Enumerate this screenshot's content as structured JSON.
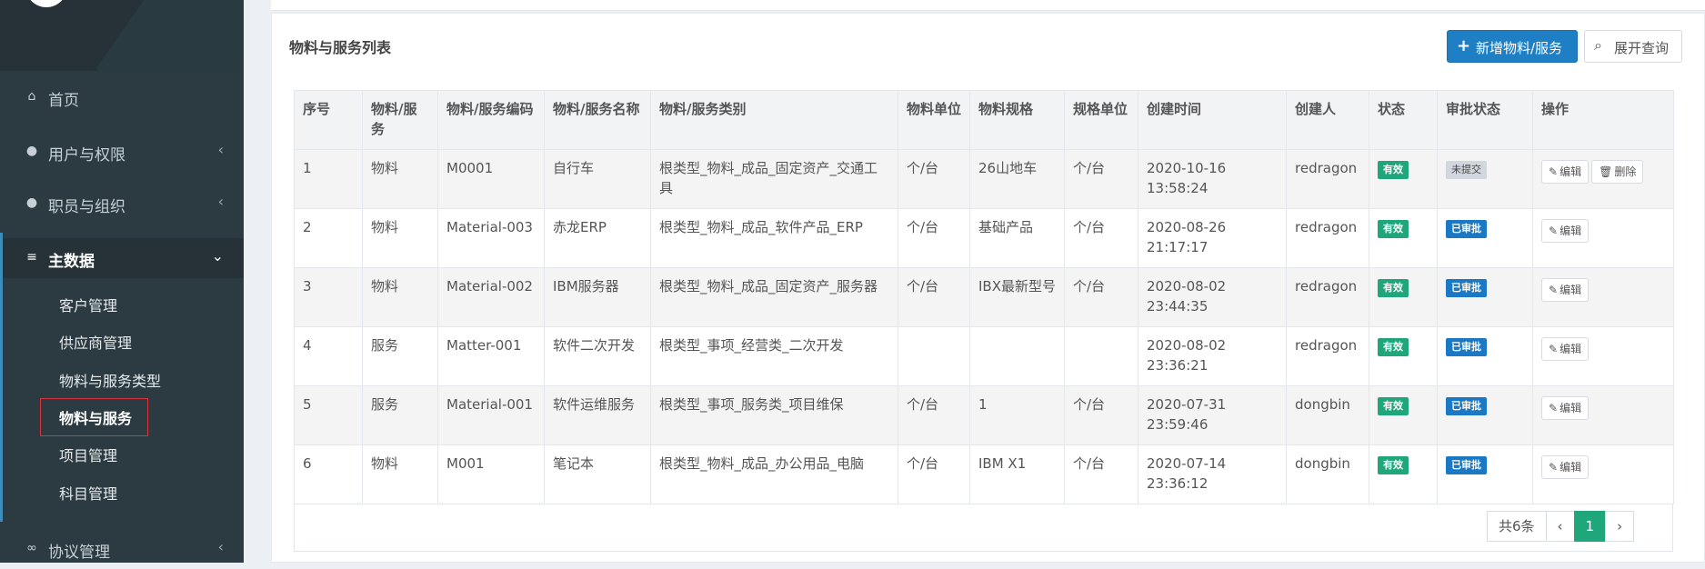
{
  "sidebar": {
    "items": [
      {
        "label": "首页",
        "icon": "home-icon",
        "glyph": "⌂"
      },
      {
        "label": "用户与权限",
        "icon": "lock-icon",
        "glyph": "●",
        "chevron": "‹"
      },
      {
        "label": "职员与组织",
        "icon": "user-circle-icon",
        "glyph": "●",
        "chevron": "‹"
      },
      {
        "label": "主数据",
        "icon": "database-icon",
        "glyph": "≡",
        "chevron": "⌄"
      },
      {
        "label": "协议管理",
        "icon": "handshake-icon",
        "glyph": "∞",
        "chevron": "‹"
      }
    ],
    "sub_items": [
      "客户管理",
      "供应商管理",
      "物料与服务类型",
      "物料与服务",
      "项目管理",
      "科目管理"
    ]
  },
  "panel": {
    "title": "物料与服务列表",
    "add_button": "新增物料/服务",
    "add_icon": "plus-icon",
    "expand_button": "展开查询",
    "expand_icon": "search-icon"
  },
  "table": {
    "headers": [
      "序号",
      "物料/服务",
      "物料/服务编码",
      "物料/服务名称",
      "物料/服务类别",
      "物料单位",
      "物料规格",
      "规格单位",
      "创建时间",
      "创建人",
      "状态",
      "审批状态",
      "操作"
    ],
    "rows": [
      {
        "no": "1",
        "type": "物料",
        "code": "M0001",
        "name": "自行车",
        "category": "根类型_物料_成品_固定资产_交通工具",
        "unit": "个/台",
        "spec": "26山地车",
        "spec_unit": "个/台",
        "created": "2020-10-16 13:58:24",
        "creator": "redragon",
        "status": "有效",
        "approval": "未提交",
        "edit": "编辑",
        "delete": "删除"
      },
      {
        "no": "2",
        "type": "物料",
        "code": "Material-003",
        "name": "赤龙ERP",
        "category": "根类型_物料_成品_软件产品_ERP",
        "unit": "个/台",
        "spec": "基础产品",
        "spec_unit": "个/台",
        "created": "2020-08-26 21:17:17",
        "creator": "redragon",
        "status": "有效",
        "approval": "已审批",
        "edit": "编辑"
      },
      {
        "no": "3",
        "type": "物料",
        "code": "Material-002",
        "name": "IBM服务器",
        "category": "根类型_物料_成品_固定资产_服务器",
        "unit": "个/台",
        "spec": "IBX最新型号",
        "spec_unit": "个/台",
        "created": "2020-08-02 23:44:35",
        "creator": "redragon",
        "status": "有效",
        "approval": "已审批",
        "edit": "编辑"
      },
      {
        "no": "4",
        "type": "服务",
        "code": "Matter-001",
        "name": "软件二次开发",
        "category": "根类型_事项_经营类_二次开发",
        "unit": "",
        "spec": "",
        "spec_unit": "",
        "created": "2020-08-02 23:36:21",
        "creator": "redragon",
        "status": "有效",
        "approval": "已审批",
        "edit": "编辑"
      },
      {
        "no": "5",
        "type": "服务",
        "code": "Material-001",
        "name": "软件运维服务",
        "category": "根类型_事项_服务类_项目维保",
        "unit": "个/台",
        "spec": "1",
        "spec_unit": "个/台",
        "created": "2020-07-31 23:59:46",
        "creator": "dongbin",
        "status": "有效",
        "approval": "已审批",
        "edit": "编辑"
      },
      {
        "no": "6",
        "type": "物料",
        "code": "M001",
        "name": "笔记本",
        "category": "根类型_物料_成品_办公用品_电脑",
        "unit": "个/台",
        "spec": "IBM X1",
        "spec_unit": "个/台",
        "created": "2020-07-14 23:36:12",
        "creator": "dongbin",
        "status": "有效",
        "approval": "已审批",
        "edit": "编辑"
      }
    ]
  },
  "pager": {
    "total": "共6条",
    "prev": "‹",
    "current": "1",
    "next": "›"
  },
  "colors": {
    "sidebar": "#2c3b41",
    "primary": "#1f7fc4",
    "valid": "#1fa67a",
    "approved": "#1b78c5",
    "highlight": "#d9333f"
  }
}
